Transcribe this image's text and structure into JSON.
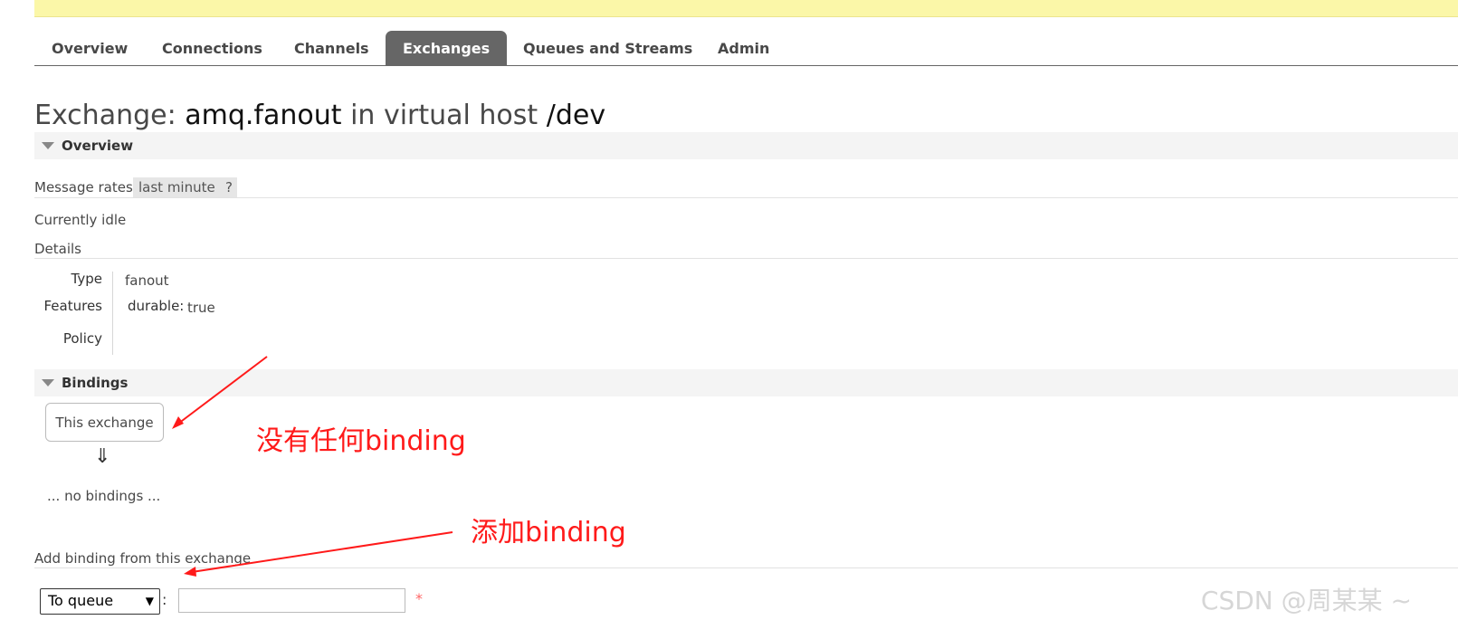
{
  "tabs": [
    {
      "label": "Overview",
      "active": false
    },
    {
      "label": "Connections",
      "active": false
    },
    {
      "label": "Channels",
      "active": false
    },
    {
      "label": "Exchanges",
      "active": true
    },
    {
      "label": "Queues and Streams",
      "active": false
    },
    {
      "label": "Admin",
      "active": false
    }
  ],
  "title": {
    "prefix": "Exchange:",
    "name": "amq.fanout",
    "mid": "in virtual host",
    "vhost": "/dev"
  },
  "overview": {
    "section_label": "Overview",
    "message_rates_label": "Message rates",
    "rate_period": "last minute",
    "help": "?",
    "status": "Currently idle",
    "details_label": "Details",
    "type_label": "Type",
    "type_value": "fanout",
    "features_label": "Features",
    "features_key": "durable:",
    "features_value": "true",
    "policy_label": "Policy"
  },
  "bindings": {
    "section_label": "Bindings",
    "this_exchange": "This exchange",
    "arrow": "⇓",
    "empty": "... no bindings ..."
  },
  "add_binding": {
    "label": "Add binding from this exchange",
    "destination_type": "To queue",
    "colon": ":",
    "destination_value": "",
    "required_mark": "*"
  },
  "annotations": {
    "no_binding": "没有任何binding",
    "add_binding": "添加binding",
    "color": "#ff1a1a"
  },
  "watermark": "CSDN @周某某 ~"
}
